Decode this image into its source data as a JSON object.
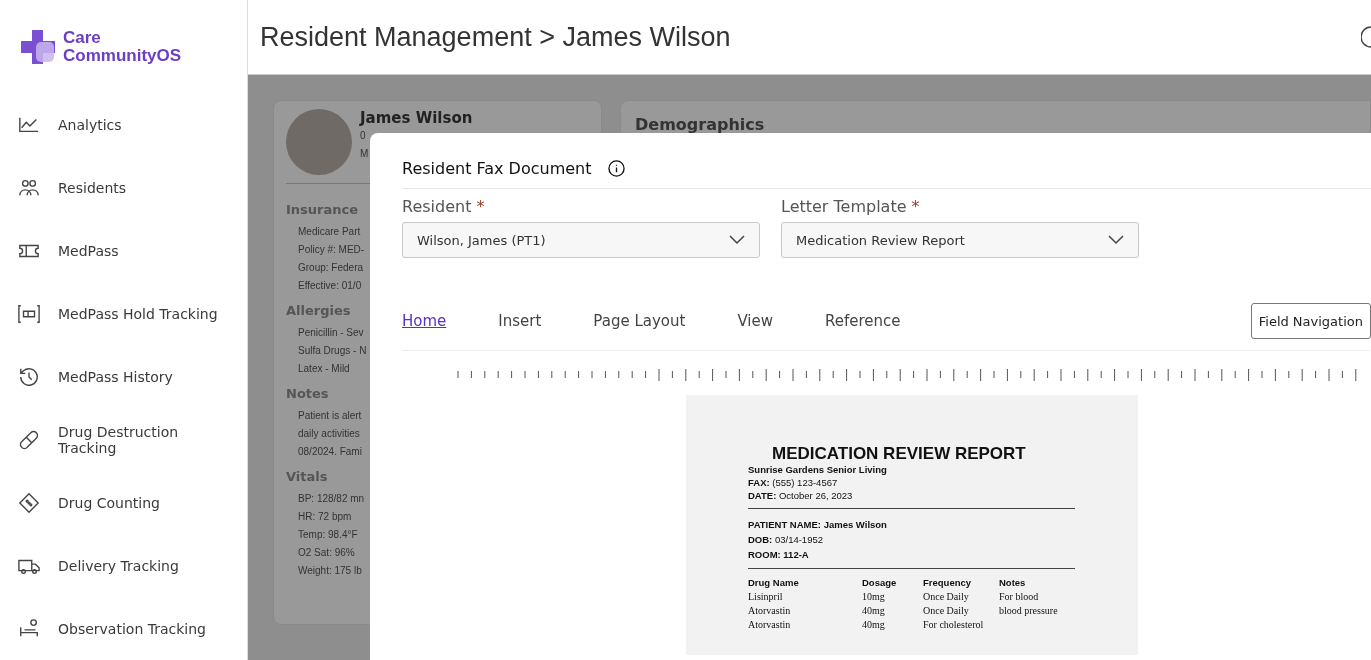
{
  "brand": {
    "line_1": "Care",
    "line_2": "CommunityOS"
  },
  "sidebar": {
    "items": [
      {
        "label": "Analytics"
      },
      {
        "label": "Residents"
      },
      {
        "label": "MedPass"
      },
      {
        "label": "MedPass Hold Tracking"
      },
      {
        "label": "MedPass History"
      },
      {
        "label": "Drug Destruction Tracking"
      },
      {
        "label": "Drug Counting"
      },
      {
        "label": "Delivery Tracking"
      },
      {
        "label": "Observation Tracking"
      }
    ]
  },
  "header": {
    "title": "Resident Management > James Wilson"
  },
  "profile": {
    "name": "James Wilson",
    "lines": [
      "0",
      "M"
    ],
    "sections": [
      {
        "title": "Insurance",
        "lines": [
          "Medicare Part",
          "Policy #: MED-",
          "Group: Federa",
          "Effective: 01/0"
        ]
      },
      {
        "title": "Allergies",
        "lines": [
          "Penicillin - Sev",
          "Sulfa Drugs - N",
          "Latex - Mild"
        ]
      },
      {
        "title": "Notes",
        "lines": [
          "Patient is alert",
          "daily activities",
          "08/2024. Fami"
        ]
      },
      {
        "title": "Vitals",
        "lines": [
          "BP: 128/82 mn",
          "HR: 72 bpm",
          "Temp: 98.4°F",
          "O2 Sat: 96%",
          "Weight: 175 lb"
        ]
      }
    ]
  },
  "demographics": {
    "title": "Demographics"
  },
  "modal": {
    "title": "Resident Fax Document",
    "fields": [
      {
        "label": "Resident",
        "required_mark": "*",
        "value": "Wilson, James (PT1)"
      },
      {
        "label": "Letter Template",
        "required_mark": "*",
        "value": "Medication Review Report"
      }
    ],
    "tabs": [
      {
        "label": "Home",
        "selected": true
      },
      {
        "label": "Insert",
        "selected": false
      },
      {
        "label": "Page Layout",
        "selected": false
      },
      {
        "label": "View",
        "selected": false
      },
      {
        "label": "Reference",
        "selected": false
      }
    ],
    "field_navigation": "Field Navigation",
    "document": {
      "title": "MEDICATION REVIEW REPORT",
      "facility": "Sunrise Gardens Senior Living",
      "info": [
        "**FAX:** (555) 123-4567",
        "**DATE:** October 26, 2023"
      ],
      "patient": [
        "**PATIENT NAME: James Wilson**",
        "**DOB:** 03/14-1952",
        "**ROOM: 112-A**"
      ],
      "columns": [
        "Drug Name",
        "Dosage",
        "Frequency",
        "Notes"
      ],
      "rows": [
        [
          "Lisinpril",
          "10mg",
          "Once Daily",
          "For blood"
        ],
        [
          "Atorvastin",
          "40mg",
          "Once Daily",
          "blood pressure"
        ],
        [
          "Atorvastin",
          "40mg",
          "For cholesterol",
          ""
        ]
      ]
    }
  }
}
